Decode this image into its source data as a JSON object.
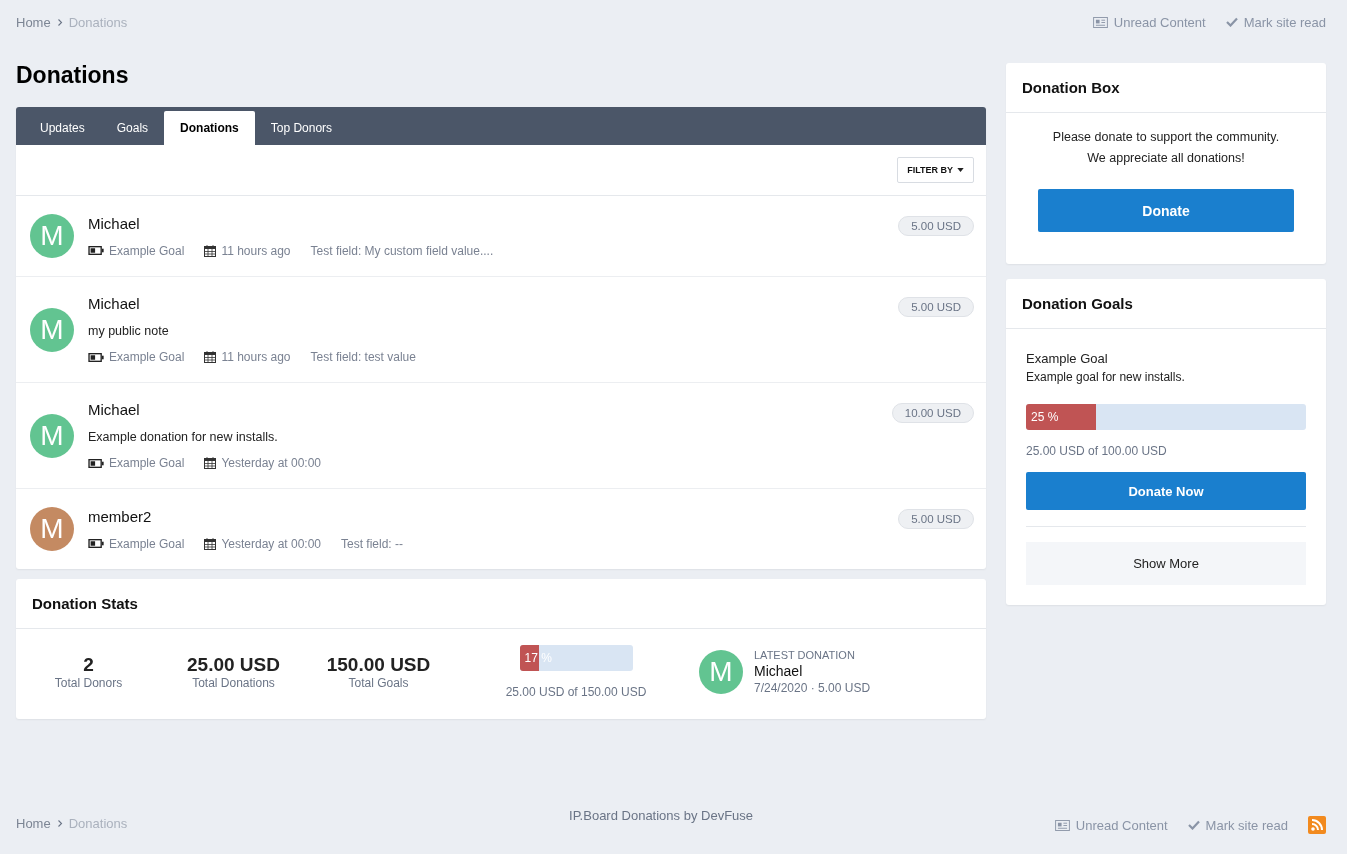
{
  "breadcrumb": [
    "Home",
    "Donations"
  ],
  "top_links": [
    {
      "kind": "unread",
      "label": "Unread Content"
    },
    {
      "kind": "mark",
      "label": "Mark site read"
    }
  ],
  "page_title": "Donations",
  "tabs": [
    {
      "label": "Updates",
      "selected": false
    },
    {
      "label": "Goals",
      "selected": false
    },
    {
      "label": "Donations",
      "selected": true
    },
    {
      "label": "Top Donors",
      "selected": false
    }
  ],
  "filter_button": "FILTER BY",
  "donations": [
    {
      "initial": "M",
      "color": "#62c491",
      "name": "Michael",
      "amount": "5.00 USD",
      "goal": "Example Goal",
      "time": "11 hours ago",
      "field": "Test field: My custom field value...."
    },
    {
      "initial": "M",
      "color": "#62c491",
      "name": "Michael",
      "note": "my public note",
      "amount": "5.00 USD",
      "goal": "Example Goal",
      "time": "11 hours ago",
      "field": "Test field: test value"
    },
    {
      "initial": "M",
      "color": "#62c491",
      "name": "Michael",
      "note": "Example donation for new installs.",
      "amount": "10.00 USD",
      "goal": "Example Goal",
      "time": "Yesterday at 00:00"
    },
    {
      "initial": "M",
      "color": "#c48a62",
      "name": "member2",
      "amount": "5.00 USD",
      "goal": "Example Goal",
      "time": "Yesterday at 00:00",
      "field": "Test field: --"
    }
  ],
  "stats": {
    "title": "Donation Stats",
    "items": [
      {
        "value": "2",
        "label": "Total Donors"
      },
      {
        "value": "25.00 USD",
        "label": "Total Donations"
      },
      {
        "value": "150.00 USD",
        "label": "Total Goals"
      }
    ],
    "progress": {
      "level": 0.17,
      "label": "17 %",
      "caption": "25.00 USD of 150.00 USD"
    },
    "latest": {
      "initial": "M",
      "color": "#62c491",
      "heading": "LATEST DONATION",
      "name": "Michael",
      "meta": "7/24/2020 · 5.00 USD"
    }
  },
  "donation_box": {
    "title": "Donation Box",
    "text": [
      "Please donate to support the community.",
      "We appreciate all donations!"
    ],
    "button": "Donate"
  },
  "donation_goals": {
    "title": "Donation Goals",
    "goals": [
      {
        "name": "Example Goal",
        "description": "Example goal for new installs.",
        "level": 0.25,
        "label": "25 %",
        "caption": "25.00 USD of 100.00 USD",
        "button": "Donate Now"
      }
    ],
    "show_more": "Show More"
  },
  "footer": {
    "breadcrumb": [
      "Home",
      "Donations"
    ],
    "credit": "IP.Board Donations by DevFuse",
    "links": [
      {
        "kind": "unread",
        "label": "Unread Content"
      },
      {
        "kind": "mark",
        "label": "Mark site read"
      }
    ],
    "rss": true
  }
}
